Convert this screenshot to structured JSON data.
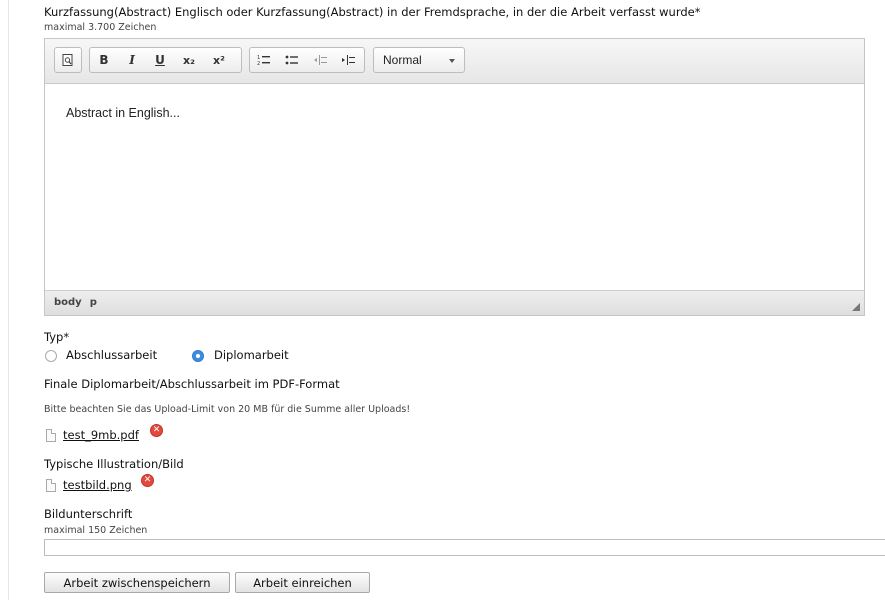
{
  "abstract": {
    "label": "Kurzfassung(Abstract) Englisch oder Kurzfassung(Abstract) in der Fremdsprache, in der die Arbeit verfasst wurde*",
    "hint": "maximal 3.700 Zeichen",
    "toolbar": {
      "source_icon": "preview-icon",
      "bold": "B",
      "italic": "I",
      "underline": "U",
      "subscript": "x₂",
      "superscript": "x²",
      "format_value": "Normal"
    },
    "content": "Abstract in English...",
    "path": [
      "body",
      "p"
    ]
  },
  "typ": {
    "label": "Typ*",
    "options": [
      {
        "label": "Abschlussarbeit",
        "selected": false
      },
      {
        "label": "Diplomarbeit",
        "selected": true
      }
    ]
  },
  "pdf": {
    "label": "Finale Diplomarbeit/Abschlussarbeit im PDF-Format",
    "notice": "Bitte beachten Sie das Upload-Limit von 20 MB für die Summe aller Uploads!",
    "file": "test_9mb.pdf"
  },
  "illustration": {
    "label": "Typische Illustration/Bild",
    "file": "testbild.png"
  },
  "caption": {
    "label": "Bildunterschrift",
    "hint": "maximal 150 Zeichen",
    "value": ""
  },
  "buttons": {
    "save": "Arbeit zwischenspeichern",
    "submit": "Arbeit einreichen"
  },
  "colors": {
    "radio_selected": "#3b8de4",
    "delete_icon": "#e14a3c"
  }
}
